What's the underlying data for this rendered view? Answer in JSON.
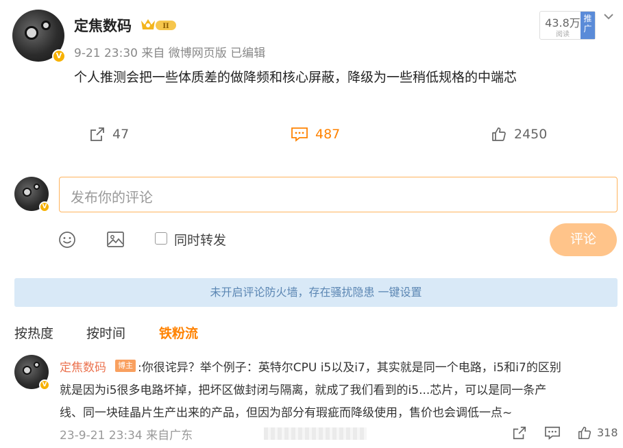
{
  "post": {
    "author": "定焦数码",
    "meta": "9-21 23:30 来自 微博网页版 已编辑",
    "text": "个人推测会把一些体质差的做降频和核心屏蔽，降级为一些稍低规格的中端芯",
    "read_count": "43.8万",
    "read_unit": "阅读",
    "promo_label": "推广",
    "actions": {
      "repost_count": "47",
      "comment_count": "487",
      "like_count": "2450"
    }
  },
  "composer": {
    "placeholder": "发布你的评论",
    "repost_label": "同时转发",
    "submit_label": "评论"
  },
  "banner": {
    "text": "未开启评论防火墙，存在骚扰隐患 一键设置"
  },
  "sort_tabs": [
    "按热度",
    "按时间",
    "铁粉流"
  ],
  "comment": {
    "author": "定焦数码",
    "badge": "博主",
    "lines": [
      ":你很诧异？举个例子：英特尔CPU i5以及i7，其实就是同一个电路，i5和i7的区别",
      "就是因为i5很多电路坏掉，把坏区做封闭与隔离，就成了我们看到的i5...芯片，可以是同一条产",
      "线、同一块硅晶片生产出来的产品，但因为部分有瑕疵而降级使用，售价也会调低一点~"
    ],
    "time": "23-9-21 23:34 来自广东",
    "likes": "318"
  },
  "colors": {
    "accent": "#ff8200",
    "banner_bg": "#d9e9f7",
    "author_link": "#eb7350"
  }
}
